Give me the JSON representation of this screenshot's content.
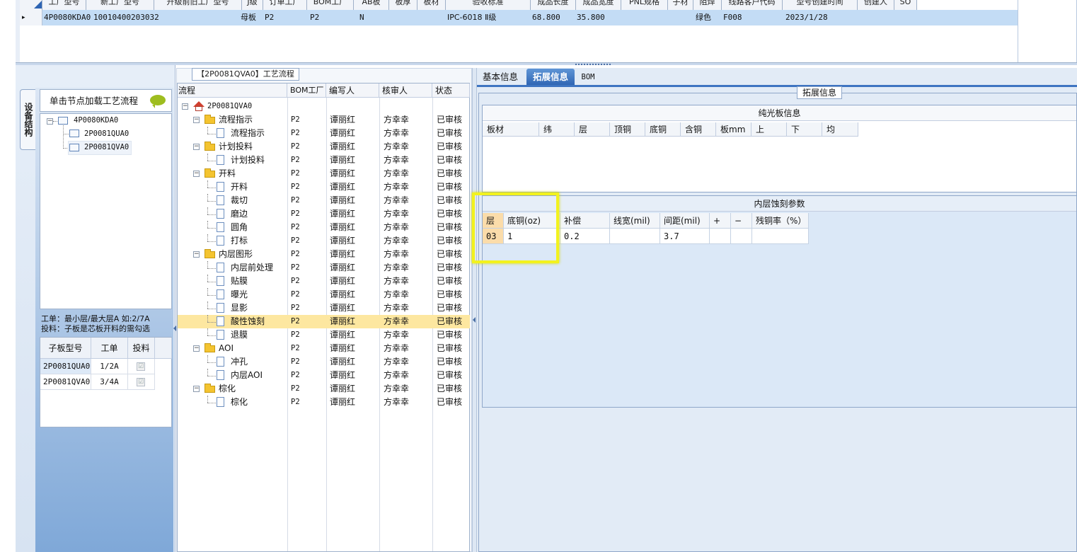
{
  "top_grid": {
    "headers": [
      "工厂型号",
      "新工厂型号",
      "升级前旧工厂型号",
      "J级",
      "订单工厂",
      "BOM工厂",
      "AB板",
      "板厚",
      "板材",
      "验收标准",
      "成品长度",
      "成品宽度",
      "PNL规格",
      "子材",
      "阻焊",
      "线路客户代码",
      "型号创建时间",
      "创建人",
      "SO"
    ],
    "row": {
      "marker": "▸",
      "model": "4P0080KDA0",
      "code": "10010400203032",
      "board_type": "母板",
      "order_factory": "P2",
      "bom_factory": "P2",
      "ab": "N",
      "standard": "IPC-6018 Ⅱ级",
      "length": "68.800",
      "width": "35.800",
      "solder_mask": "绿色",
      "customer_code": "F008",
      "created": "2023/1/28"
    }
  },
  "left_panel": {
    "vertical_tab": "设备结构",
    "header": "单击节点加载工艺流程",
    "tree": [
      {
        "label": "4P0080KDA0",
        "level": 0
      },
      {
        "label": "2P0081QUA0",
        "level": 1
      },
      {
        "label": "2P0081QVA0",
        "level": 1,
        "selected": true
      }
    ],
    "note_line1": "工单：最小层/最大层A 如:2/7A",
    "note_line2": "投料：子板是芯板开料的需勾选",
    "sub_headers": [
      "子板型号",
      "工单",
      "投料"
    ],
    "sub_rows": [
      {
        "model": "2P0081QUA0",
        "order": "1/2A",
        "feed": "☑"
      },
      {
        "model": "2P0081QVA0",
        "order": "3/4A",
        "feed": "☑"
      }
    ]
  },
  "process": {
    "title": "【2P0081QVA0】工艺流程",
    "headers": [
      "流程",
      "BOM工厂",
      "编写人",
      "核审人",
      "状态"
    ],
    "root": "2P0081QVA0",
    "rows": [
      {
        "name": "流程指示",
        "type": "folder",
        "bom": "P2",
        "writer": "谭丽红",
        "reviewer": "方幸幸",
        "status": "已审核"
      },
      {
        "name": "流程指示",
        "type": "page",
        "bom": "P2",
        "writer": "谭丽红",
        "reviewer": "方幸幸",
        "status": "已审核"
      },
      {
        "name": "计划投料",
        "type": "folder",
        "bom": "P2",
        "writer": "谭丽红",
        "reviewer": "方幸幸",
        "status": "已审核"
      },
      {
        "name": "计划投料",
        "type": "page",
        "bom": "P2",
        "writer": "谭丽红",
        "reviewer": "方幸幸",
        "status": "已审核"
      },
      {
        "name": "开料",
        "type": "folder",
        "bom": "P2",
        "writer": "谭丽红",
        "reviewer": "方幸幸",
        "status": "已审核"
      },
      {
        "name": "开料",
        "type": "page",
        "bom": "P2",
        "writer": "谭丽红",
        "reviewer": "方幸幸",
        "status": "已审核"
      },
      {
        "name": "裁切",
        "type": "page",
        "bom": "P2",
        "writer": "谭丽红",
        "reviewer": "方幸幸",
        "status": "已审核"
      },
      {
        "name": "磨边",
        "type": "page",
        "bom": "P2",
        "writer": "谭丽红",
        "reviewer": "方幸幸",
        "status": "已审核"
      },
      {
        "name": "圆角",
        "type": "page",
        "bom": "P2",
        "writer": "谭丽红",
        "reviewer": "方幸幸",
        "status": "已审核"
      },
      {
        "name": "打标",
        "type": "page",
        "bom": "P2",
        "writer": "谭丽红",
        "reviewer": "方幸幸",
        "status": "已审核"
      },
      {
        "name": "内层图形",
        "type": "folder",
        "bom": "P2",
        "writer": "谭丽红",
        "reviewer": "方幸幸",
        "status": "已审核"
      },
      {
        "name": "内层前处理",
        "type": "page",
        "bom": "P2",
        "writer": "谭丽红",
        "reviewer": "方幸幸",
        "status": "已审核"
      },
      {
        "name": "贴膜",
        "type": "page",
        "bom": "P2",
        "writer": "谭丽红",
        "reviewer": "方幸幸",
        "status": "已审核"
      },
      {
        "name": "曝光",
        "type": "page",
        "bom": "P2",
        "writer": "谭丽红",
        "reviewer": "方幸幸",
        "status": "已审核"
      },
      {
        "name": "显影",
        "type": "page",
        "bom": "P2",
        "writer": "谭丽红",
        "reviewer": "方幸幸",
        "status": "已审核"
      },
      {
        "name": "酸性蚀刻",
        "type": "page",
        "bom": "P2",
        "writer": "谭丽红",
        "reviewer": "方幸幸",
        "status": "已审核",
        "selected": true
      },
      {
        "name": "退膜",
        "type": "page",
        "bom": "P2",
        "writer": "谭丽红",
        "reviewer": "方幸幸",
        "status": "已审核"
      },
      {
        "name": "AOI",
        "type": "folder",
        "bom": "P2",
        "writer": "谭丽红",
        "reviewer": "方幸幸",
        "status": "已审核"
      },
      {
        "name": "冲孔",
        "type": "page",
        "bom": "P2",
        "writer": "谭丽红",
        "reviewer": "方幸幸",
        "status": "已审核"
      },
      {
        "name": "内层AOI",
        "type": "page",
        "bom": "P2",
        "writer": "谭丽红",
        "reviewer": "方幸幸",
        "status": "已审核"
      },
      {
        "name": "棕化",
        "type": "folder",
        "bom": "P2",
        "writer": "谭丽红",
        "reviewer": "方幸幸",
        "status": "已审核"
      },
      {
        "name": "棕化",
        "type": "page",
        "bom": "P2",
        "writer": "谭丽红",
        "reviewer": "方幸幸",
        "status": "已审核"
      }
    ]
  },
  "right_panel": {
    "tabs": [
      "基本信息",
      "拓展信息",
      "BOM"
    ],
    "active_tab": "拓展信息",
    "group_label": "拓展信息",
    "plain_board": {
      "title": "纯光板信息",
      "headers": [
        "板材",
        "纬",
        "层",
        "顶铜",
        "底铜",
        "含铜",
        "板mm",
        "上",
        "下",
        "均"
      ]
    },
    "inner_etch": {
      "title": "内层蚀刻参数",
      "headers": [
        "层",
        "底铜(oz)",
        "补偿",
        "线宽(mil)",
        "间距(mil)",
        "+",
        "−",
        "残铜率（%）"
      ],
      "row": [
        "03",
        "1",
        "0.2",
        "",
        "3.7",
        "",
        "",
        ""
      ]
    }
  },
  "colors": {
    "accent": "#2e64b3",
    "highlight": "#fde7a0",
    "annotation_box": "#f2f21e"
  }
}
